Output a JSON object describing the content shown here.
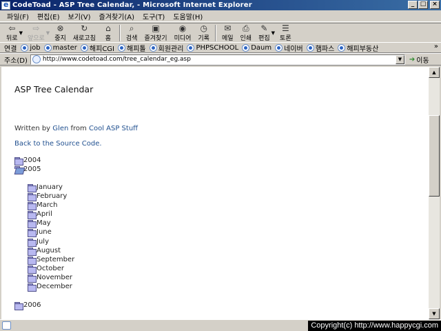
{
  "window": {
    "title": "CodeToad - ASP Tree Calendar, - Microsoft Internet Explorer",
    "controls": {
      "minimize": "_",
      "maximize": "□",
      "close": "×"
    }
  },
  "menu": [
    "파일(F)",
    "편집(E)",
    "보기(V)",
    "즐겨찾기(A)",
    "도구(T)",
    "도움말(H)"
  ],
  "toolbar": {
    "back": "뒤로",
    "forward": "앞으로",
    "stop": "중지",
    "refresh": "새로고침",
    "home": "홈",
    "search": "검색",
    "favorites": "즐겨찾기",
    "media": "미디어",
    "history": "기록",
    "mail": "메일",
    "print": "인쇄",
    "edit": "편집",
    "discuss": "토론"
  },
  "links": {
    "label": "연결",
    "items": [
      "job",
      "master",
      "해피CGI",
      "해피톨",
      "회원관리",
      "PHPSCHOOL",
      "Daum",
      "네이버",
      "햄파스",
      "해피부동산"
    ],
    "more": "»"
  },
  "address": {
    "label": "주소(D)",
    "url": "http://www.codetoad.com/tree_calendar_eg.asp",
    "go": "이동"
  },
  "page": {
    "title": "ASP Tree Calendar",
    "written_prefix": "Written by",
    "author": "Glen",
    "from_word": "from",
    "site": "Cool ASP Stuff",
    "back_link": "Back to the Source Code."
  },
  "tree": {
    "years": [
      {
        "label": "2004",
        "open": false
      },
      {
        "label": "2005",
        "open": true
      },
      {
        "label": "2006",
        "open": false
      }
    ],
    "months": [
      "January",
      "February",
      "March",
      "April",
      "May",
      "June",
      "July",
      "August",
      "September",
      "October",
      "November",
      "December"
    ]
  },
  "status": {
    "copyright": "Copyright(c) http://www.happycgi.com"
  }
}
